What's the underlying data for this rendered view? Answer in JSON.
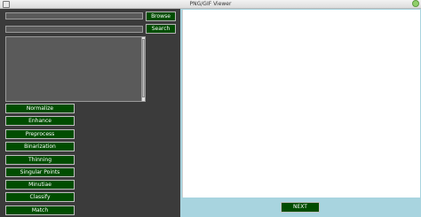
{
  "window": {
    "title": "PNG/GIF Viewer",
    "icon": "window-icon",
    "close_icon": "close-icon"
  },
  "controls": {
    "path_field_value": "",
    "search_field_value": "",
    "browse_label": "Browse",
    "search_label": "Search",
    "output_text": ""
  },
  "actions": [
    {
      "label": "Normalize"
    },
    {
      "label": "Enhance"
    },
    {
      "label": "Preprocess"
    },
    {
      "label": "Binarization"
    },
    {
      "label": "Thinning"
    },
    {
      "label": "Singular Points"
    },
    {
      "label": "Minutiae"
    },
    {
      "label": "Classify"
    },
    {
      "label": "Match"
    }
  ],
  "viewer": {
    "next_label": "NEXT"
  },
  "colors": {
    "button_bg": "#004d00",
    "panel_bg": "#3b3b3b",
    "viewer_bg": "#a8d4df"
  }
}
